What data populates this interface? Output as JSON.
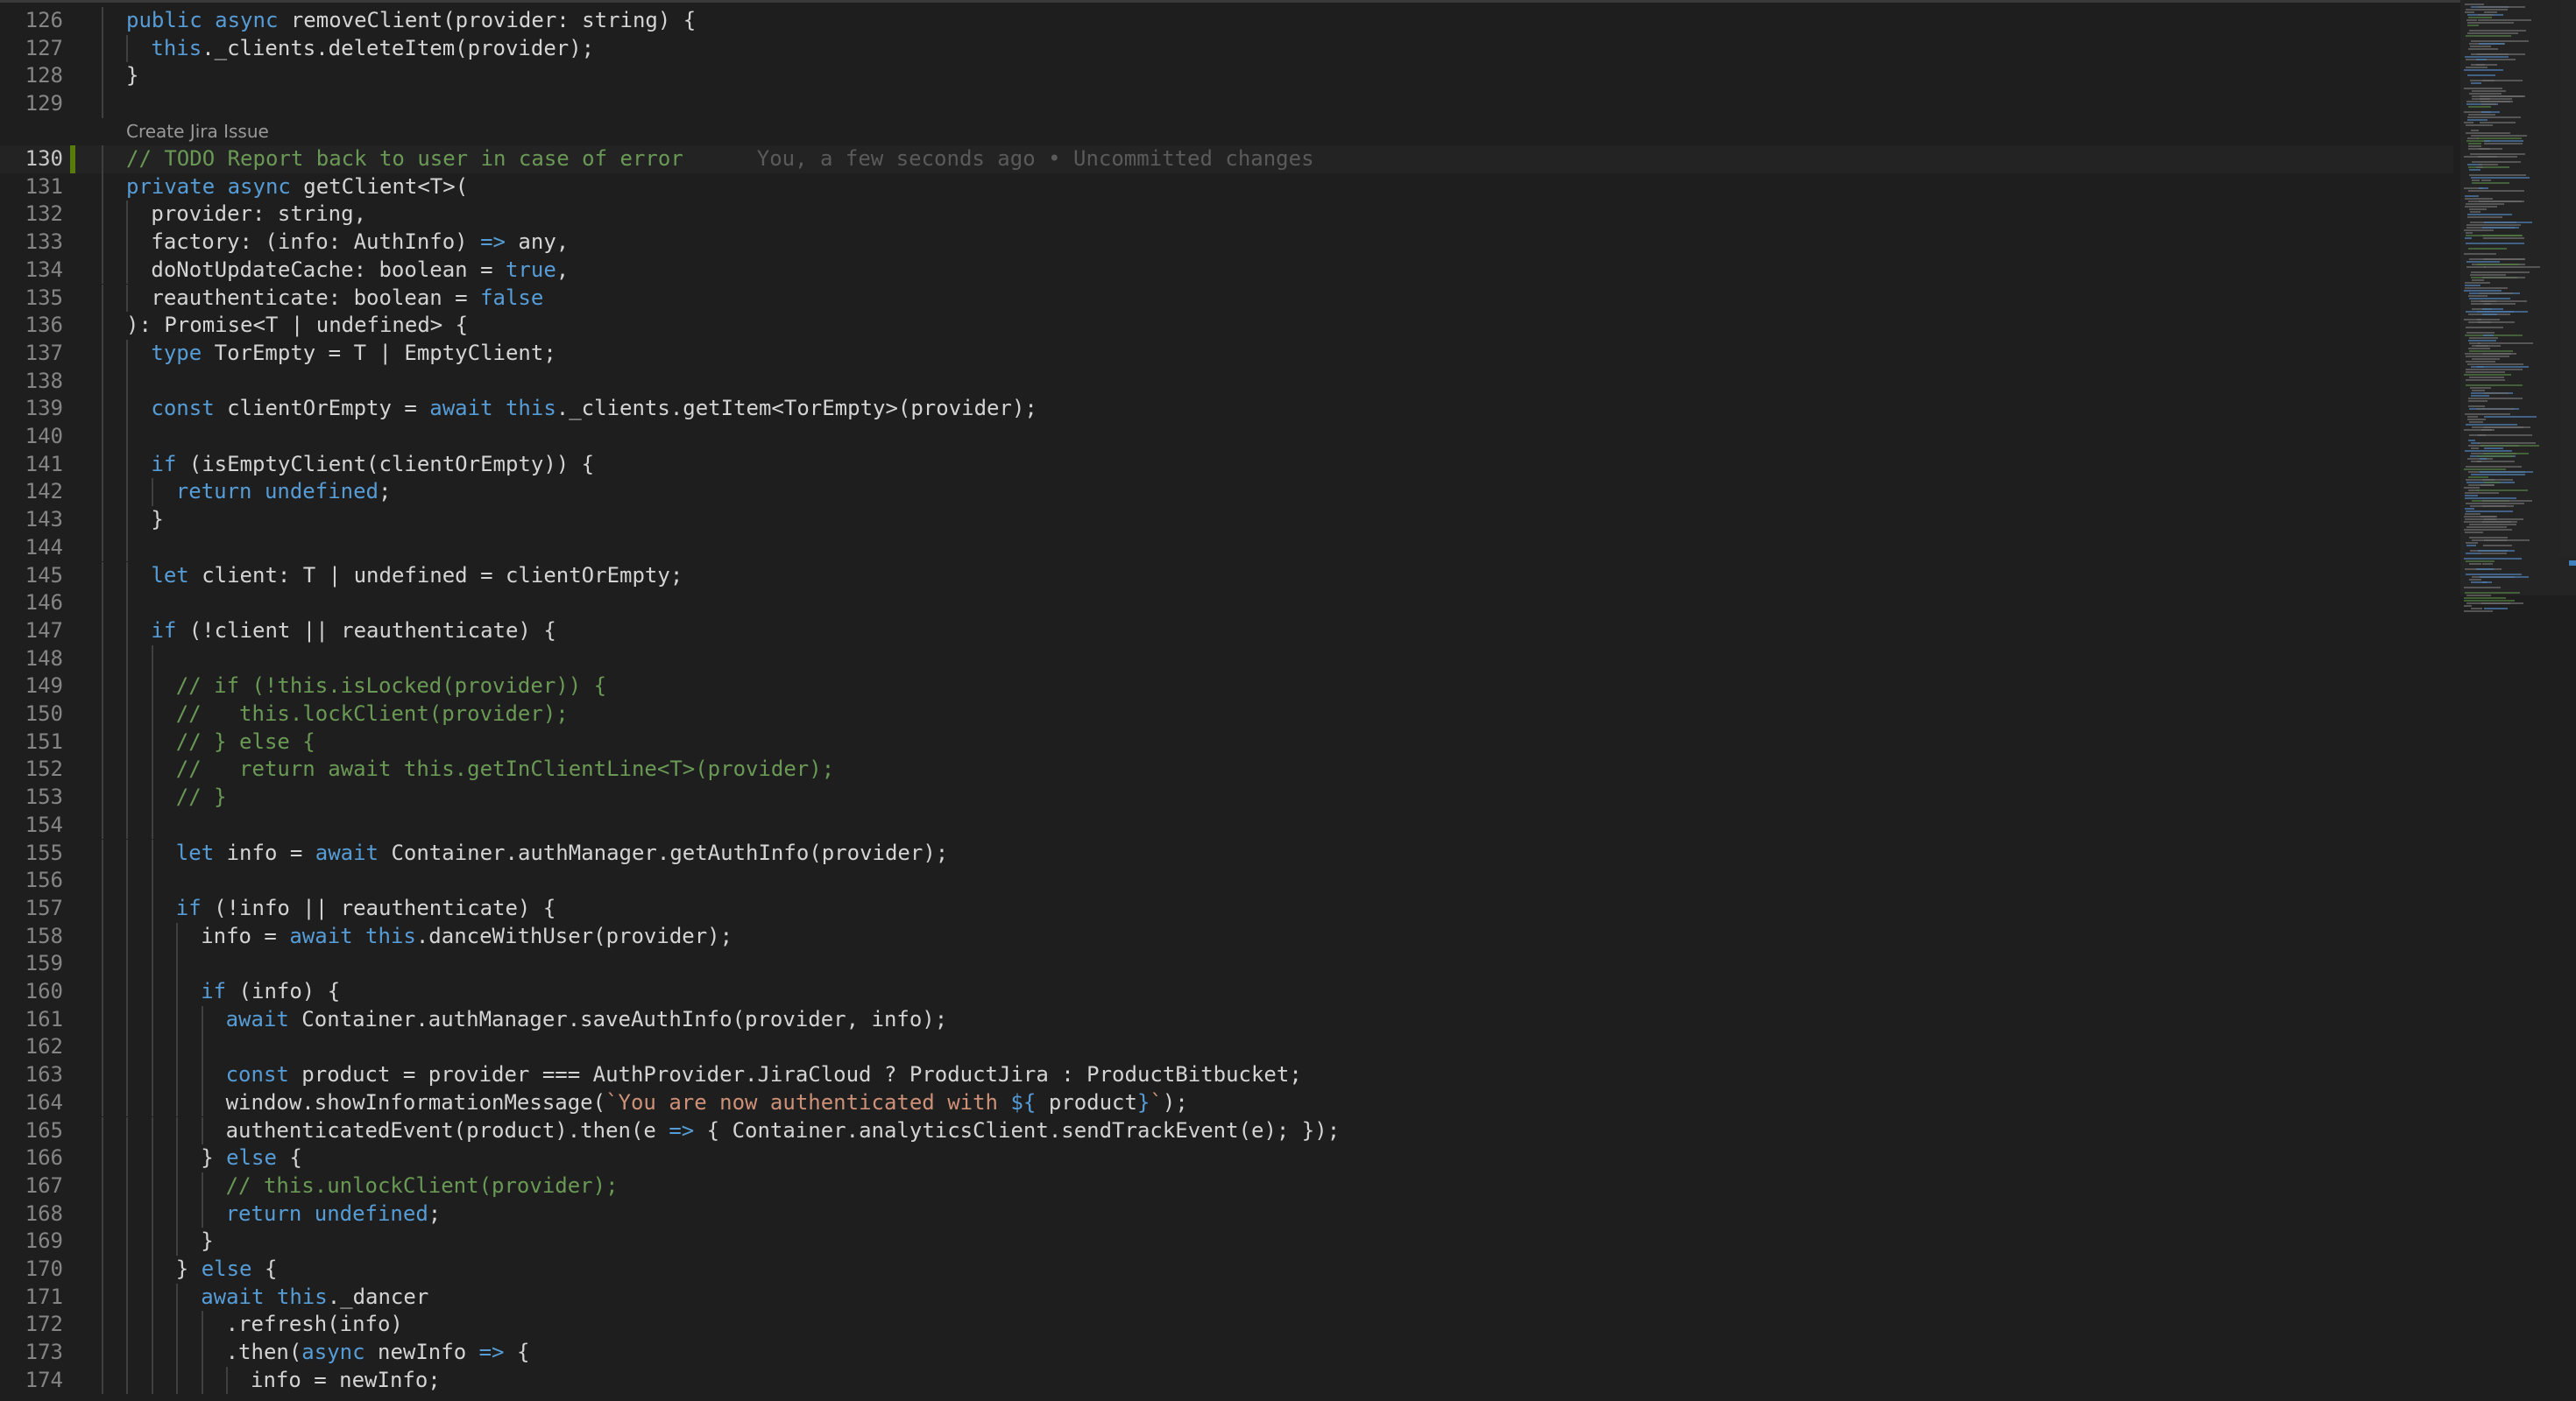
{
  "codelens": {
    "label": "Create Jira Issue"
  },
  "blame": {
    "text": "You, a few seconds ago • Uncommitted changes"
  },
  "lines": [
    {
      "n": "126",
      "indent": 0,
      "tokens": [
        [
          "kw",
          "public async"
        ],
        [
          "",
          "removeClient(provider: string) {"
        ]
      ]
    },
    {
      "n": "127",
      "indent": 1,
      "tokens": [
        [
          "kw",
          "this"
        ],
        [
          "",
          "._clients.deleteItem(provider);"
        ]
      ]
    },
    {
      "n": "128",
      "indent": 0,
      "tokens": [
        [
          "",
          "}"
        ]
      ]
    },
    {
      "n": "129",
      "indent": 0,
      "tokens": []
    },
    {
      "n": "130",
      "indent": 0,
      "active": true,
      "tokens": [
        [
          "cm",
          "// TODO Report back to user in case of error"
        ]
      ]
    },
    {
      "n": "131",
      "indent": 0,
      "tokens": [
        [
          "kw",
          "private async"
        ],
        [
          "",
          "getClient<T>("
        ]
      ]
    },
    {
      "n": "132",
      "indent": 1,
      "tokens": [
        [
          "",
          "provider: string,"
        ]
      ]
    },
    {
      "n": "133",
      "indent": 1,
      "tokens": [
        [
          "",
          "factory: (info: AuthInfo) "
        ],
        [
          "kw",
          "=>"
        ],
        [
          "",
          " any,"
        ]
      ]
    },
    {
      "n": "134",
      "indent": 1,
      "tokens": [
        [
          "",
          "doNotUpdateCache: boolean = "
        ],
        [
          "kw",
          "true"
        ],
        [
          "",
          ","
        ]
      ]
    },
    {
      "n": "135",
      "indent": 1,
      "tokens": [
        [
          "",
          "reauthenticate: boolean = "
        ],
        [
          "kw",
          "false"
        ]
      ]
    },
    {
      "n": "136",
      "indent": 0,
      "tokens": [
        [
          "",
          "): Promise<T | undefined> {"
        ]
      ]
    },
    {
      "n": "137",
      "indent": 1,
      "tokens": [
        [
          "kw",
          "type"
        ],
        [
          "",
          " TorEmpty = T | EmptyClient;"
        ]
      ]
    },
    {
      "n": "138",
      "indent": 1,
      "tokens": []
    },
    {
      "n": "139",
      "indent": 1,
      "tokens": [
        [
          "kw",
          "const"
        ],
        [
          "",
          " clientOrEmpty = "
        ],
        [
          "kw",
          "await this"
        ],
        [
          "",
          "._clients.getItem<TorEmpty>(provider);"
        ]
      ]
    },
    {
      "n": "140",
      "indent": 1,
      "tokens": []
    },
    {
      "n": "141",
      "indent": 1,
      "tokens": [
        [
          "kw",
          "if"
        ],
        [
          "",
          " (isEmptyClient(clientOrEmpty)) {"
        ]
      ]
    },
    {
      "n": "142",
      "indent": 2,
      "tokens": [
        [
          "kw",
          "return undefined"
        ],
        [
          "",
          ";"
        ]
      ]
    },
    {
      "n": "143",
      "indent": 1,
      "tokens": [
        [
          "",
          "}"
        ]
      ]
    },
    {
      "n": "144",
      "indent": 1,
      "tokens": []
    },
    {
      "n": "145",
      "indent": 1,
      "tokens": [
        [
          "kw",
          "let"
        ],
        [
          "",
          " client: T | undefined = clientOrEmpty;"
        ]
      ]
    },
    {
      "n": "146",
      "indent": 1,
      "tokens": []
    },
    {
      "n": "147",
      "indent": 1,
      "tokens": [
        [
          "kw",
          "if"
        ],
        [
          "",
          " (!client || reauthenticate) {"
        ]
      ]
    },
    {
      "n": "148",
      "indent": 2,
      "tokens": []
    },
    {
      "n": "149",
      "indent": 2,
      "tokens": [
        [
          "cm",
          "// if (!this.isLocked(provider)) {"
        ]
      ]
    },
    {
      "n": "150",
      "indent": 2,
      "tokens": [
        [
          "cm",
          "//   this.lockClient(provider);"
        ]
      ]
    },
    {
      "n": "151",
      "indent": 2,
      "tokens": [
        [
          "cm",
          "// } else {"
        ]
      ]
    },
    {
      "n": "152",
      "indent": 2,
      "tokens": [
        [
          "cm",
          "//   return await this.getInClientLine<T>(provider);"
        ]
      ]
    },
    {
      "n": "153",
      "indent": 2,
      "tokens": [
        [
          "cm",
          "// }"
        ]
      ]
    },
    {
      "n": "154",
      "indent": 2,
      "tokens": []
    },
    {
      "n": "155",
      "indent": 2,
      "tokens": [
        [
          "kw",
          "let"
        ],
        [
          "",
          " info = "
        ],
        [
          "kw",
          "await"
        ],
        [
          "",
          " Container.authManager.getAuthInfo(provider);"
        ]
      ]
    },
    {
      "n": "156",
      "indent": 2,
      "tokens": []
    },
    {
      "n": "157",
      "indent": 2,
      "tokens": [
        [
          "kw",
          "if"
        ],
        [
          "",
          " (!info || reauthenticate) {"
        ]
      ]
    },
    {
      "n": "158",
      "indent": 3,
      "tokens": [
        [
          "",
          "info = "
        ],
        [
          "kw",
          "await this"
        ],
        [
          "",
          ".danceWithUser(provider);"
        ]
      ]
    },
    {
      "n": "159",
      "indent": 3,
      "tokens": []
    },
    {
      "n": "160",
      "indent": 3,
      "tokens": [
        [
          "kw",
          "if"
        ],
        [
          "",
          " (info) {"
        ]
      ]
    },
    {
      "n": "161",
      "indent": 4,
      "tokens": [
        [
          "kw",
          "await"
        ],
        [
          "",
          " Container.authManager.saveAuthInfo(provider, info);"
        ]
      ]
    },
    {
      "n": "162",
      "indent": 4,
      "tokens": []
    },
    {
      "n": "163",
      "indent": 4,
      "tokens": [
        [
          "kw",
          "const"
        ],
        [
          "",
          " product = provider === AuthProvider.JiraCloud ? ProductJira : ProductBitbucket;"
        ]
      ]
    },
    {
      "n": "164",
      "indent": 4,
      "tokens": [
        [
          "",
          "window.showInformationMessage("
        ],
        [
          "str",
          "`You are now authenticated with "
        ],
        [
          "kw",
          "${"
        ],
        [
          "",
          "product"
        ],
        [
          "kw",
          "}"
        ],
        [
          "str",
          "`"
        ],
        [
          "",
          ");"
        ]
      ]
    },
    {
      "n": "165",
      "indent": 4,
      "tokens": [
        [
          "",
          "authenticatedEvent(product).then(e "
        ],
        [
          "kw",
          "=>"
        ],
        [
          "",
          " { Container.analyticsClient.sendTrackEvent(e); });"
        ]
      ]
    },
    {
      "n": "166",
      "indent": 3,
      "tokens": [
        [
          "",
          "} "
        ],
        [
          "kw",
          "else"
        ],
        [
          "",
          " {"
        ]
      ]
    },
    {
      "n": "167",
      "indent": 4,
      "tokens": [
        [
          "cm",
          "// this.unlockClient(provider);"
        ]
      ]
    },
    {
      "n": "168",
      "indent": 4,
      "tokens": [
        [
          "kw",
          "return undefined"
        ],
        [
          "",
          ";"
        ]
      ]
    },
    {
      "n": "169",
      "indent": 3,
      "tokens": [
        [
          "",
          "}"
        ]
      ]
    },
    {
      "n": "170",
      "indent": 2,
      "tokens": [
        [
          "",
          "} "
        ],
        [
          "kw",
          "else"
        ],
        [
          "",
          " {"
        ]
      ]
    },
    {
      "n": "171",
      "indent": 3,
      "tokens": [
        [
          "kw",
          "await this"
        ],
        [
          "",
          "._dancer"
        ]
      ]
    },
    {
      "n": "172",
      "indent": 4,
      "tokens": [
        [
          "",
          ".refresh(info)"
        ]
      ]
    },
    {
      "n": "173",
      "indent": 4,
      "tokens": [
        [
          "",
          ".then("
        ],
        [
          "kw",
          "async"
        ],
        [
          "",
          " newInfo "
        ],
        [
          "kw",
          "=>"
        ],
        [
          "",
          " {"
        ]
      ]
    },
    {
      "n": "174",
      "indent": 5,
      "tokens": [
        [
          "",
          "info = newInfo;"
        ]
      ]
    }
  ]
}
